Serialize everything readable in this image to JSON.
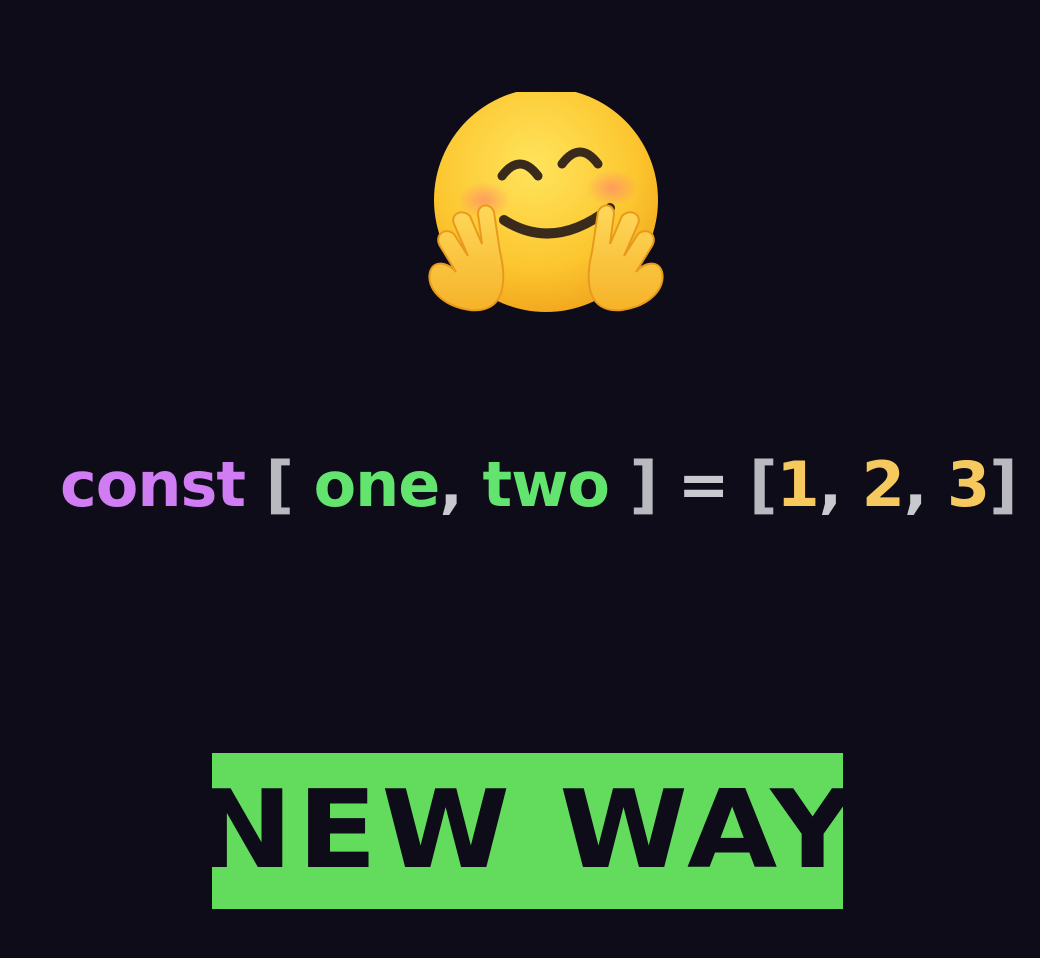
{
  "emoji": {
    "icon": "hugging-face-icon"
  },
  "code": {
    "keyword": "const",
    "open_bracket": "[",
    "var_one": "one",
    "comma_1": ",",
    "var_two": "two",
    "close_bracket": "]",
    "equals": "=",
    "arr_open": "[",
    "num_1": "1",
    "comma_2": ",",
    "num_2": "2",
    "comma_3": ",",
    "num_3": "3",
    "arr_close": "]"
  },
  "badge": {
    "label": "NEW WAY"
  },
  "colors": {
    "background": "#0e0c18",
    "keyword": "#d07cf2",
    "variable": "#63e46e",
    "number": "#f5c95e",
    "bracket": "#b9b9c0",
    "badge_bg": "#63dc5e"
  }
}
